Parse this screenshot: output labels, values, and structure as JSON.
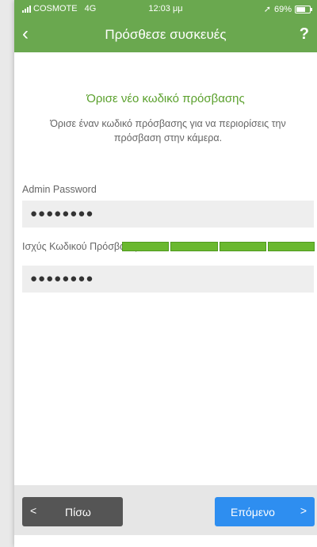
{
  "status_bar": {
    "carrier": "COSMOTE",
    "network": "4G",
    "time": "12:03 μμ",
    "battery": "69%"
  },
  "nav": {
    "title": "Πρόσθεσε συσκευές",
    "back_icon": "‹",
    "help": "?"
  },
  "content": {
    "heading": "Όρισε νέο κωδικό πρόσβασης",
    "description": "Όρισε έναν κωδικό πρόσβασης για να περιορίσεις την πρόσβαση στην κάμερα.",
    "admin_label": "Admin Password",
    "admin_value": "●●●●●●●●",
    "strength_label": "Ισχύς Κωδικού Πρόσβασης:",
    "strength_level": 1.0,
    "confirm_value": "●●●●●●●●"
  },
  "footer": {
    "back_label": "Πίσω",
    "next_label": "Επόμενο"
  },
  "colors": {
    "header": "#6aa84f",
    "heading": "#5aa02c",
    "strength": "#6ab82f",
    "back_button": "#555555",
    "next_button": "#2e8ef0"
  }
}
